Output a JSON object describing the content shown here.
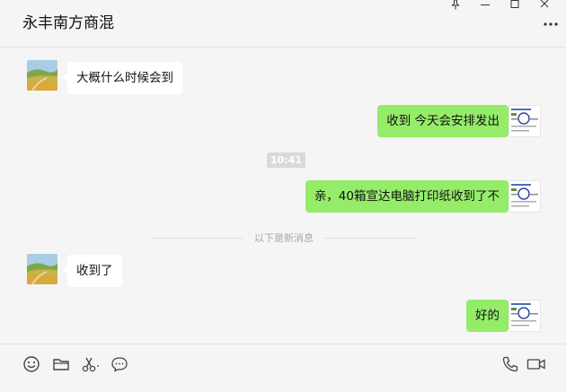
{
  "header": {
    "title": "永丰南方商混"
  },
  "messages": [
    {
      "side": "left",
      "text": "大概什么时候会到"
    },
    {
      "side": "right",
      "text": "收到 今天会安排发出"
    },
    {
      "side": "right",
      "text": "亲，40箱宣达电脑打印纸收到了不"
    },
    {
      "side": "left",
      "text": "收到了"
    },
    {
      "side": "right",
      "text": "好的"
    }
  ],
  "timestamp": "10:41",
  "new_messages_divider": "以下是新消息",
  "toolbar": {
    "left_icons": [
      "emoji-icon",
      "folder-icon",
      "scissors-icon",
      "chat-bubble-icon"
    ],
    "right_icons": [
      "phone-icon",
      "video-icon"
    ]
  },
  "window_controls": [
    "pin-icon",
    "minimize-icon",
    "maximize-icon",
    "close-icon"
  ],
  "colors": {
    "bubble_right": "#95ec69",
    "bubble_left": "#ffffff",
    "background": "#f5f5f5"
  }
}
